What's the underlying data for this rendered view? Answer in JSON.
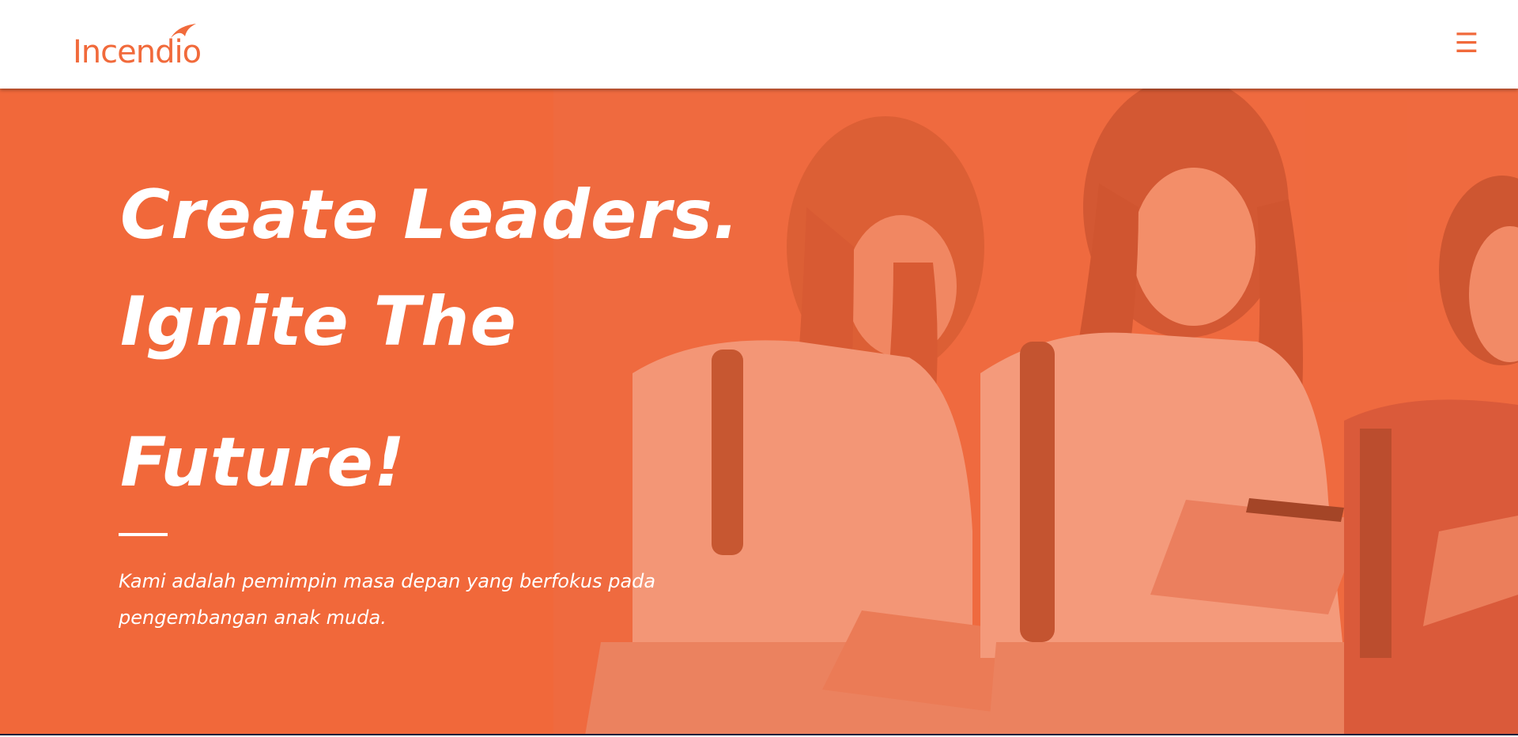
{
  "brand": {
    "name": "Incendio",
    "primary_color": "#F16A3B",
    "overlay_color": "#F26A3A"
  },
  "navbar": {
    "menu_icon": "hamburger-menu-icon",
    "menu_glyph": "☰"
  },
  "hero": {
    "title_lines": [
      "Create Leaders.",
      "Ignite The",
      "Future!"
    ],
    "subtitle": "Kami adalah pemimpin masa depan yang berfokus pada pengembangan anak muda.",
    "background_image": "three students sitting with tablets"
  }
}
